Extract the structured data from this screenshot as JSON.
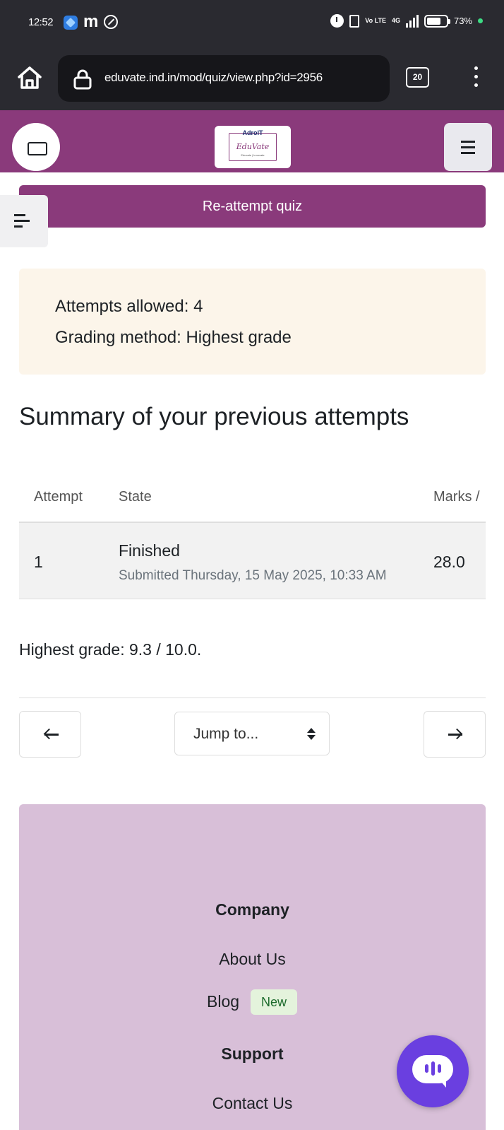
{
  "status_bar": {
    "time": "12:52",
    "app_icon": "m",
    "volte": "Vo LTE",
    "network": "4G",
    "battery": "73%"
  },
  "browser": {
    "url": "eduvate.ind.in/mod/quiz/view.php?id=2956",
    "tab_count": "20"
  },
  "site": {
    "logo_top": "AdroIT",
    "logo_main": "EduVate",
    "logo_sub": "Educate | Innovate"
  },
  "quiz": {
    "reattempt_label": "Re-attempt quiz",
    "attempts_allowed": "Attempts allowed: 4",
    "grading_method": "Grading method: Highest grade",
    "summary_title": "Summary of your previous attempts",
    "table": {
      "headers": [
        "Attempt",
        "State",
        "Marks /"
      ],
      "rows": [
        {
          "attempt": "1",
          "state": "Finished",
          "submitted": "Submitted Thursday, 15 May 2025, 10:33 AM",
          "marks": "28.0"
        }
      ]
    },
    "highest_grade": "Highest grade: 9.3 / 10.0."
  },
  "navigation": {
    "jump_label": "Jump to..."
  },
  "footer": {
    "company_heading": "Company",
    "about_us": "About Us",
    "blog": "Blog",
    "new_badge": "New",
    "support_heading": "Support",
    "contact_us": "Contact Us"
  },
  "colors": {
    "brand": "#8a3a7b",
    "info_bg": "#fcf5ea",
    "footer_bg": "#d8bfd8",
    "chat": "#6a3fe0"
  }
}
